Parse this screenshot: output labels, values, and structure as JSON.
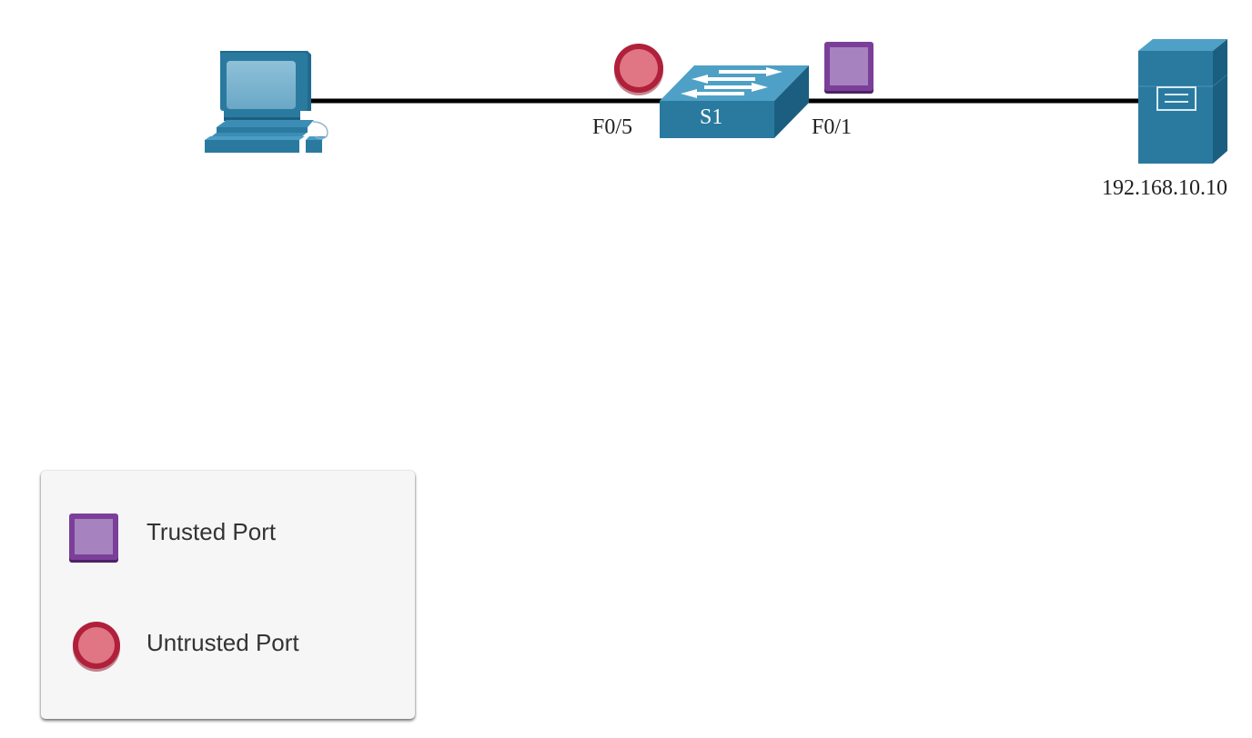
{
  "diagram": {
    "switch_label": "S1",
    "port_left_label": "F0/5",
    "port_right_label": "F0/1",
    "server_ip": "192.168.10.10",
    "devices": {
      "pc_icon": "desktop-computer-icon",
      "switch_icon": "network-switch-icon",
      "server_icon": "file-server-icon"
    }
  },
  "legend": {
    "items": [
      {
        "label": "Trusted Port",
        "symbol": "square",
        "color": "#7b3f99",
        "fill": "#a683bf"
      },
      {
        "label": "Untrusted Port",
        "symbol": "circle",
        "color": "#b0203a",
        "fill": "#e07684"
      }
    ]
  },
  "colors": {
    "device_blue": "#2a7aa0",
    "link_black": "#000000"
  }
}
